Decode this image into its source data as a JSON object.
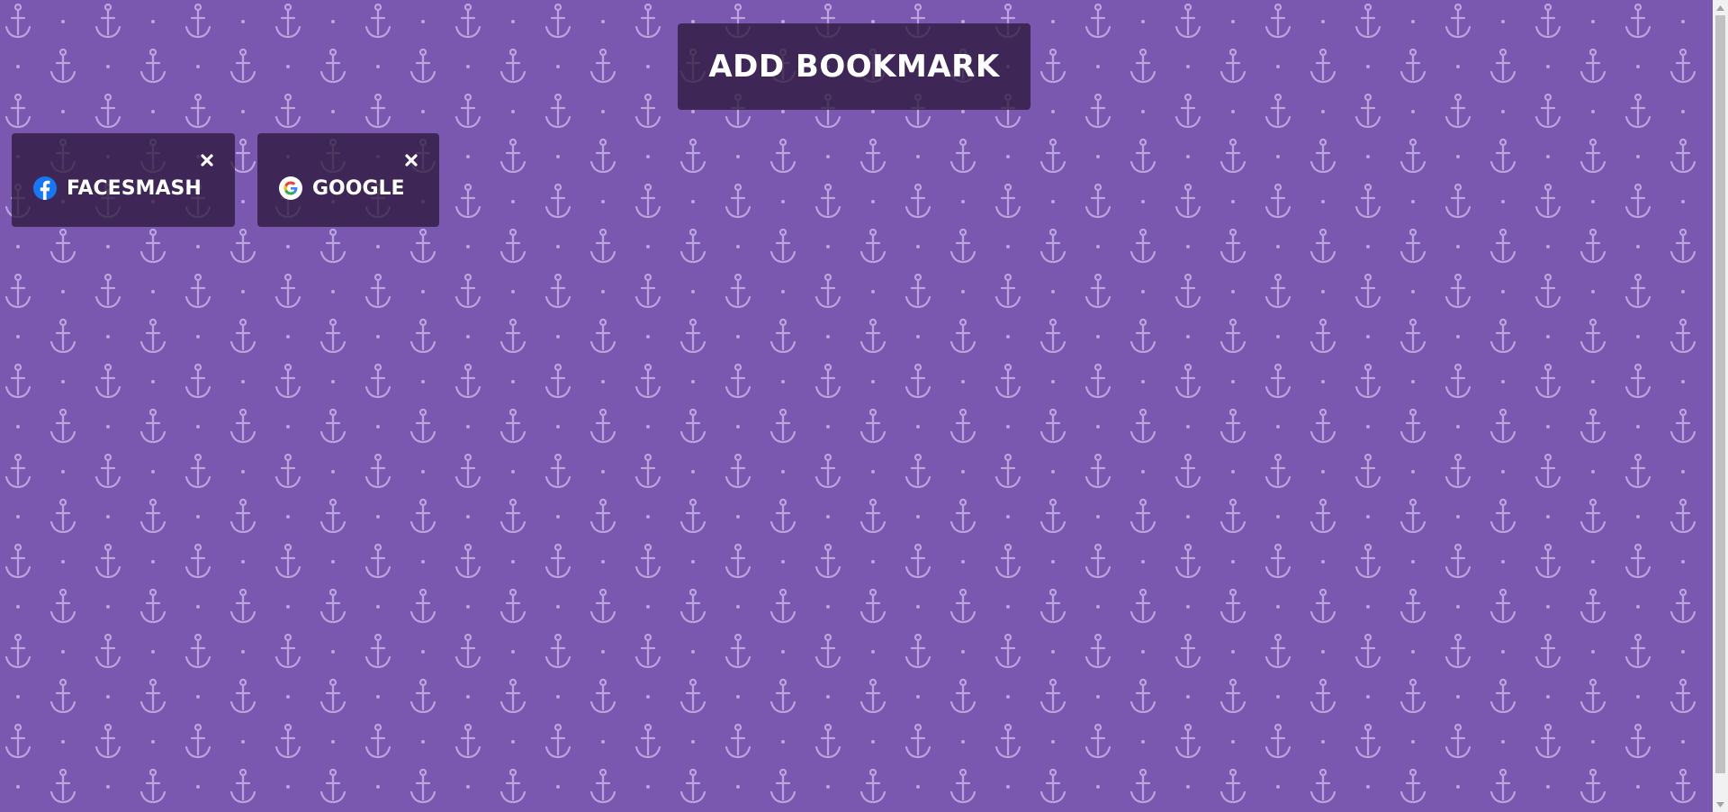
{
  "header": {
    "add_bookmark_label": "ADD BOOKMARK"
  },
  "bookmarks": [
    {
      "label": "FACESMASH",
      "icon": "facebook-icon",
      "close_icon": "close-icon"
    },
    {
      "label": "GOOGLE",
      "icon": "google-icon",
      "close_icon": "close-icon"
    }
  ],
  "colors": {
    "background": "#7a58b0",
    "pattern": "#c9b2e8",
    "card": "#2d193c",
    "text": "#ffffff",
    "facebook_blue": "#1877f2"
  }
}
